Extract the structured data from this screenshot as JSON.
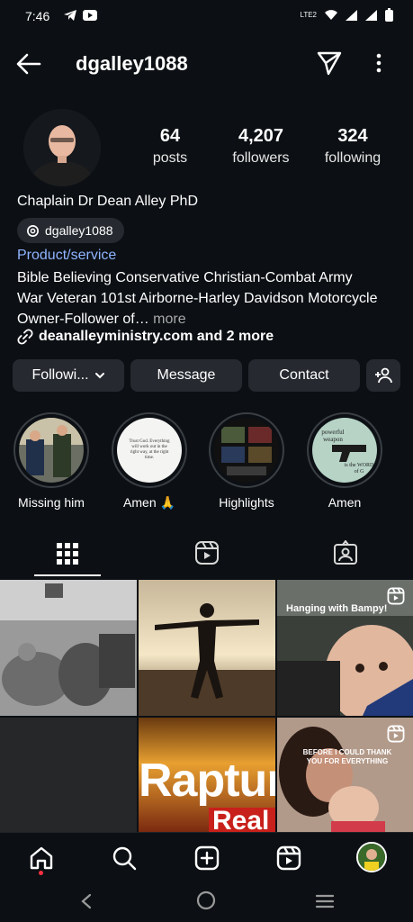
{
  "status_bar": {
    "time": "7:46",
    "network_label": "LTE2"
  },
  "header": {
    "username": "dgalley1088"
  },
  "profile": {
    "stats": [
      {
        "num": "64",
        "label": "posts"
      },
      {
        "num": "4,207",
        "label": "followers"
      },
      {
        "num": "324",
        "label": "following"
      }
    ],
    "full_name": "Chaplain Dr Dean Alley PhD",
    "threads_handle": "dgalley1088",
    "category": "Product/service",
    "bio_line1": "Bible Believing Conservative Christian-Combat Army",
    "bio_line2": "War Veteran 101st Airborne-Harley Davidson Motorcycle",
    "bio_line3": "Owner-Follower of…",
    "bio_more": " more",
    "link": "deanalleyministry.com and 2 more"
  },
  "actions": {
    "following": "Followi...",
    "message": "Message",
    "contact": "Contact"
  },
  "highlights": [
    {
      "label": "Missing him"
    },
    {
      "label": "Amen 🙏",
      "text": "Trust God. Everything will work out in the right way, at the right time."
    },
    {
      "label": "Highlights"
    },
    {
      "label": "Amen",
      "text_top": "powerful weapon",
      "text_bottom": "is the WORD of G"
    }
  ],
  "grid": {
    "post3_caption": "Hanging with Bampy!",
    "post5_text1": "Raptur",
    "post5_text2": "Real",
    "post6_caption": "BEFORE I COULD THANK YOU FOR EVERYTHING"
  },
  "colors": {
    "background": "#0c1014",
    "button": "#262a30",
    "link": "#8fb4ff",
    "accent_red": "#ff3040"
  }
}
